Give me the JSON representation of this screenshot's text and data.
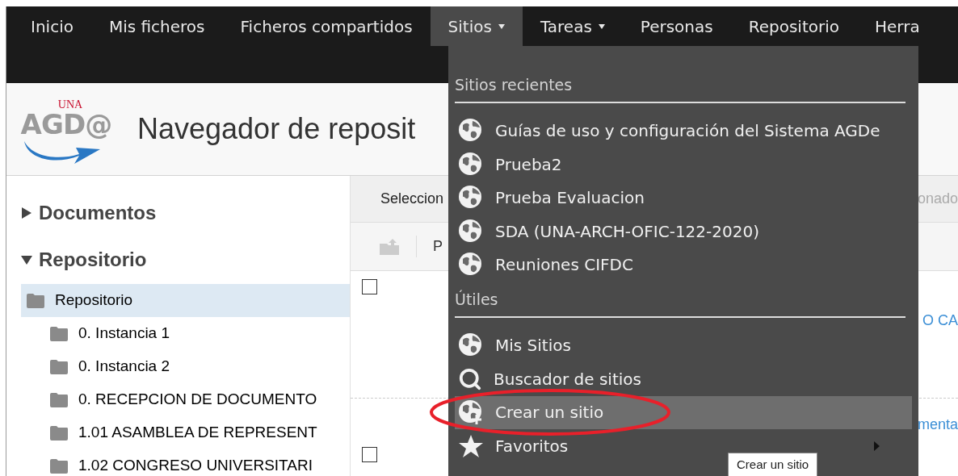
{
  "nav": {
    "items": [
      {
        "label": "Inicio",
        "selected": false,
        "has_menu": false
      },
      {
        "label": "Mis ficheros",
        "selected": false,
        "has_menu": false
      },
      {
        "label": "Ficheros compartidos",
        "selected": false,
        "has_menu": false
      },
      {
        "label": "Sitios",
        "selected": true,
        "has_menu": true
      },
      {
        "label": "Tareas",
        "selected": false,
        "has_menu": true
      },
      {
        "label": "Personas",
        "selected": false,
        "has_menu": false
      },
      {
        "label": "Repositorio",
        "selected": false,
        "has_menu": false
      },
      {
        "label": "Herra",
        "selected": false,
        "has_menu": false
      }
    ]
  },
  "header": {
    "logo": {
      "top": "UNA",
      "main": "AGD@"
    },
    "title": "Navegador de reposit"
  },
  "sidebar": {
    "sections": [
      {
        "label": "Documentos",
        "expanded": false
      },
      {
        "label": "Repositorio",
        "expanded": true,
        "tree": [
          {
            "label": "Repositorio",
            "selected": true,
            "children": [
              {
                "label": "0. Instancia 1",
                "selected": false
              },
              {
                "label": "0. Instancia 2",
                "selected": false
              },
              {
                "label": "0. RECEPCION DE DOCUMENTO",
                "selected": false
              },
              {
                "label": "1.01 ASAMBLEA DE REPRESENT",
                "selected": false
              },
              {
                "label": "1.02 CONGRESO UNIVERSITARI",
                "selected": false
              }
            ]
          }
        ]
      }
    ]
  },
  "content": {
    "toolbar_left": "Seleccion",
    "toolbar_right": "onado",
    "action": "P",
    "rows": [
      {
        "checked": false,
        "link": "O CA"
      },
      {
        "link": "menta"
      },
      {
        "checked": false
      }
    ]
  },
  "menu": {
    "sections": [
      {
        "title": "Sitios recientes",
        "items": [
          {
            "label": "Guías de uso y configuración del Sistema AGDe",
            "kind": "globe",
            "highlighted": false,
            "submenu": false,
            "circled": false
          },
          {
            "label": "Prueba2",
            "kind": "globe",
            "highlighted": false,
            "submenu": false,
            "circled": false
          },
          {
            "label": "Prueba Evaluacion",
            "kind": "globe",
            "highlighted": false,
            "submenu": false,
            "circled": false
          },
          {
            "label": "SDA (UNA-ARCH-OFIC-122-2020)",
            "kind": "globe",
            "highlighted": false,
            "submenu": false,
            "circled": false
          },
          {
            "label": "Reuniones CIFDC",
            "kind": "globe",
            "highlighted": false,
            "submenu": false,
            "circled": false
          }
        ]
      },
      {
        "title": "Útiles",
        "items": [
          {
            "label": "Mis Sitios",
            "kind": "globe",
            "highlighted": false,
            "submenu": false,
            "circled": false
          },
          {
            "label": "Buscador de sitios",
            "kind": "search",
            "highlighted": false,
            "submenu": false,
            "circled": false
          },
          {
            "label": "Crear un sitio",
            "kind": "globe-add",
            "highlighted": true,
            "submenu": false,
            "circled": true
          },
          {
            "label": "Favoritos",
            "kind": "star",
            "highlighted": false,
            "submenu": true,
            "circled": false
          }
        ]
      }
    ],
    "tooltip": "Crear un sitio"
  }
}
